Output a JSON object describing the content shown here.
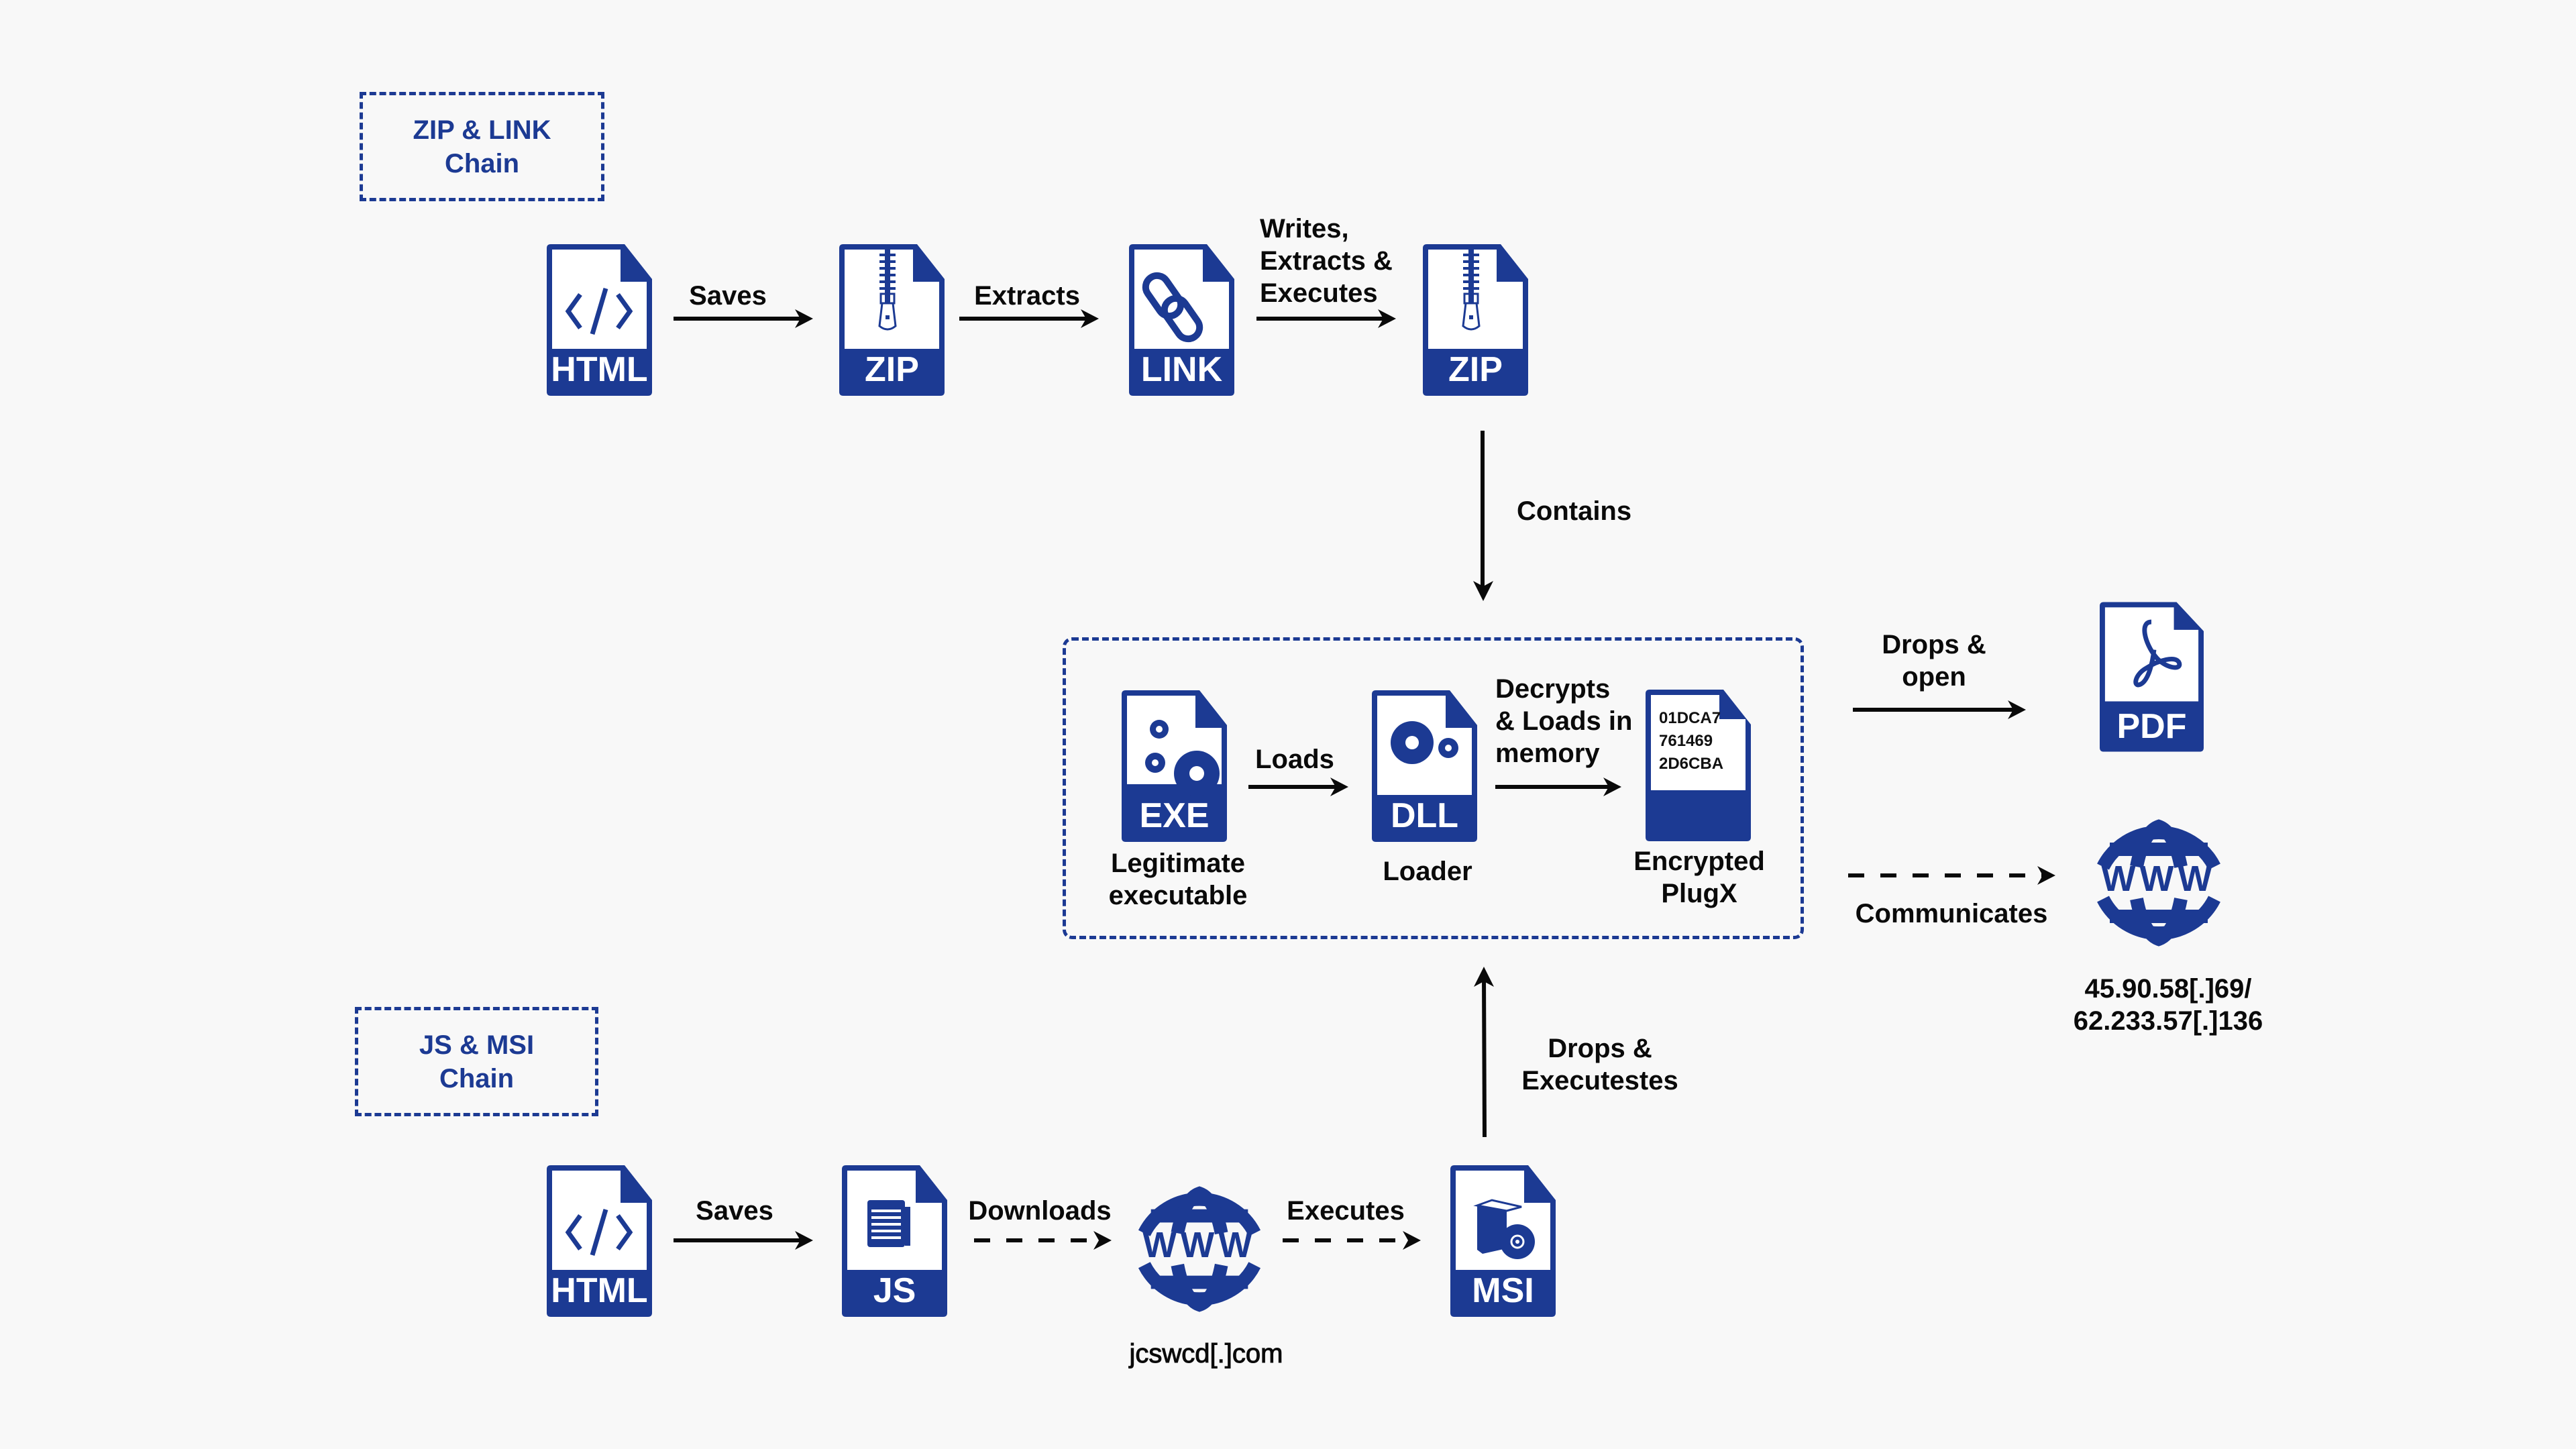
{
  "colors": {
    "brand_blue": "#1c3a93",
    "background": "#f8f8f8",
    "text": "#0a0a0a"
  },
  "chains": {
    "zip_link": {
      "title": "ZIP & LINK\nChain"
    },
    "js_msi": {
      "title": "JS & MSI\nChain"
    }
  },
  "top_row": {
    "files": [
      {
        "ext": "HTML",
        "icon": "code-icon"
      },
      {
        "ext": "ZIP",
        "icon": "zipper-icon"
      },
      {
        "ext": "LINK",
        "icon": "chain-link-icon"
      },
      {
        "ext": "ZIP",
        "icon": "zipper-icon"
      }
    ],
    "edges": [
      {
        "label": "Saves",
        "style": "solid"
      },
      {
        "label": "Extracts",
        "style": "solid"
      },
      {
        "label": "Writes,\nExtracts &\nExecutes",
        "style": "solid"
      }
    ],
    "contains_label": "Contains"
  },
  "core": {
    "exe": {
      "ext": "EXE",
      "icon": "gears-icon",
      "caption": "Legitimate\nexecutable"
    },
    "dll": {
      "ext": "DLL",
      "icon": "gears-icon",
      "caption": "Loader"
    },
    "payload": {
      "hex_lines": "01DCA7\n761469\n2D6CBA",
      "caption": "Encrypted\nPlugX"
    },
    "loads_label": "Loads",
    "decrypts_label": "Decrypts\n& Loads in\nmemory"
  },
  "outputs": {
    "pdf": {
      "ext": "PDF",
      "icon": "acrobat-icon",
      "edge_label": "Drops &\nopen"
    },
    "c2": {
      "edge_label": "Communicates",
      "globe_text": "WWW",
      "address": "45.90.58[.]69/\n62.233.57[.]136"
    }
  },
  "bottom_row": {
    "files": [
      {
        "ext": "HTML",
        "icon": "code-icon"
      },
      {
        "ext": "JS",
        "icon": "script-icon"
      },
      {
        "ext": "MSI",
        "icon": "installer-icon"
      }
    ],
    "edges": [
      {
        "label": "Saves",
        "style": "solid"
      },
      {
        "label": "Downloads",
        "style": "dashed"
      },
      {
        "label": "Executes",
        "style": "dashed"
      }
    ],
    "domain": {
      "globe_text": "WWW",
      "address": "jcswcd[.]com"
    },
    "drops_label": "Drops &\nExecutestes"
  }
}
